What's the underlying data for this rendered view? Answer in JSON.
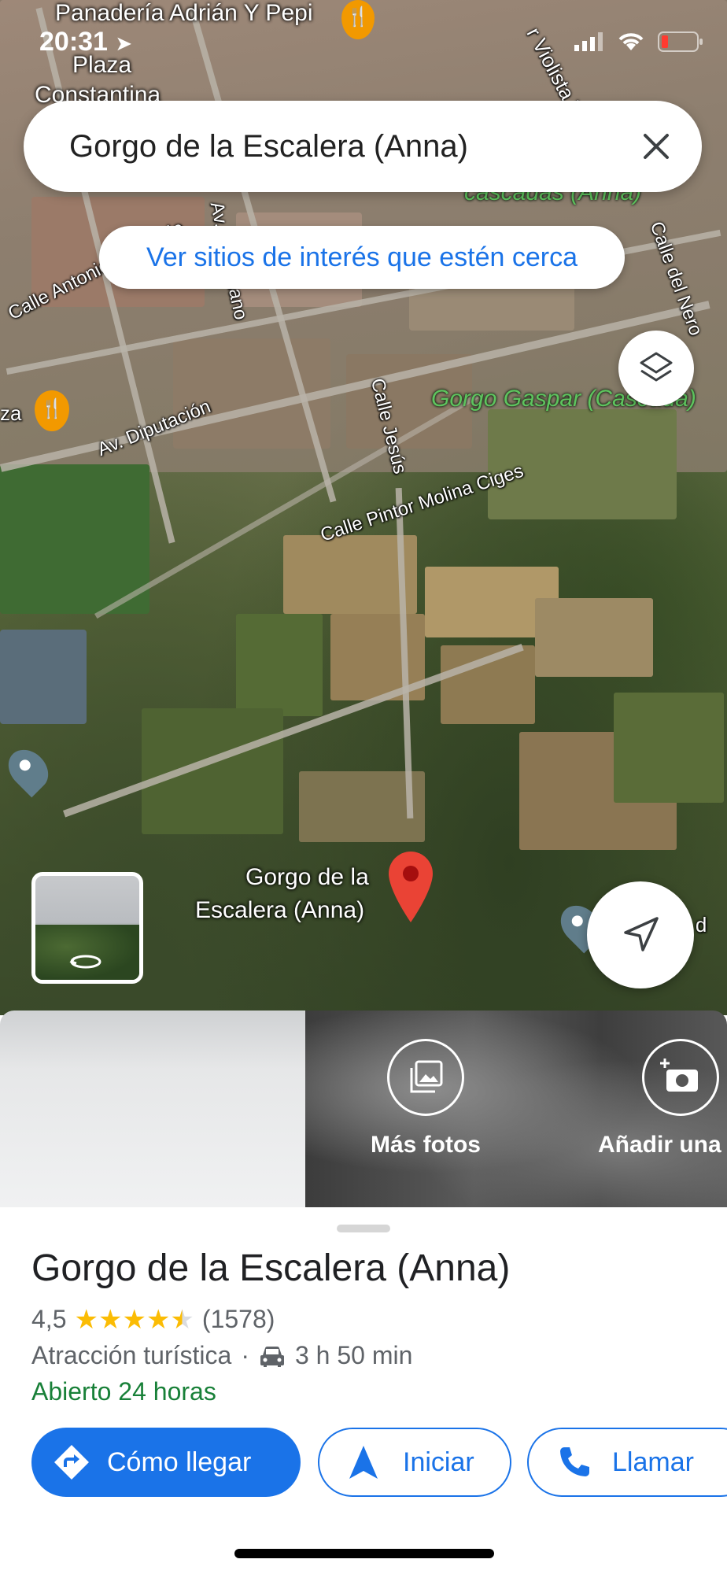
{
  "status_bar": {
    "time": "20:31"
  },
  "search": {
    "query": "Gorgo de la Escalera (Anna)"
  },
  "nearby_chip": {
    "label": "Ver sitios de interés que estén cerca"
  },
  "map_labels": {
    "panaderia": "Panadería Adrián Y Pepi",
    "plaza": "Plaza",
    "constantina": "Constantina",
    "calle_antonio": "Calle Antonio Machado",
    "av_pe": "Av. Pe... ciano",
    "calle_jesus": "Calle Jesús",
    "gorgo_gaspar": "Gorgo Gaspar (Cascada)",
    "cascadas_anna": "cascadas (Anna)",
    "av_diputacion": "Av. Diputación",
    "calle_pintor": "Calle Pintor Molina Ciges",
    "calle_nero": "Calle del Nero",
    "violista": "r Violista Vall",
    "za": "za",
    "pin_label_line1": "Gorgo de la",
    "pin_label_line2": "Escalera (Anna)",
    "cascada_right": "Cascada d"
  },
  "photos": {
    "more_photos_label": "Más fotos",
    "add_photo_label": "Añadir una f"
  },
  "place": {
    "title": "Gorgo de la Escalera (Anna)",
    "rating": "4,5",
    "rating_value": 4.5,
    "review_count": "(1578)",
    "category": "Atracción turística",
    "separator": "·",
    "drive_time": "3 h 50 min",
    "hours": "Abierto 24 horas"
  },
  "actions": {
    "directions": "Cómo llegar",
    "start": "Iniciar",
    "call": "Llamar"
  },
  "colors": {
    "accent_blue": "#1a73e8",
    "open_green": "#188038",
    "pin_red": "#ea4335",
    "star_yellow": "#fbbc04"
  }
}
